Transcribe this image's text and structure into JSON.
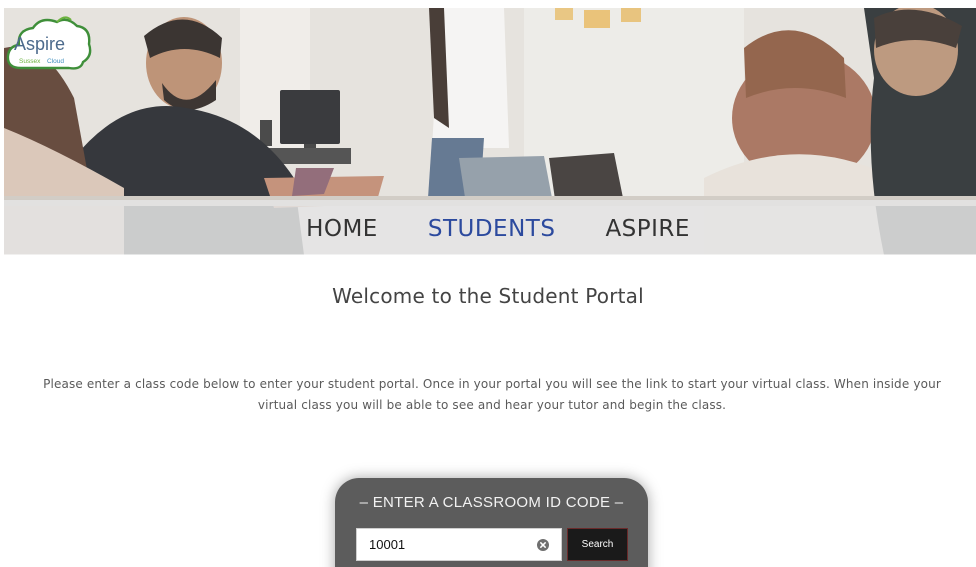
{
  "logo": {
    "text": "Aspire",
    "sub_left": "Sussex",
    "sub_right": "Cloud"
  },
  "nav": {
    "items": [
      {
        "label": "HOME",
        "active": false
      },
      {
        "label": "STUDENTS",
        "active": true
      },
      {
        "label": "ASPIRE",
        "active": false
      }
    ]
  },
  "main": {
    "welcome": "Welcome to the Student Portal",
    "intro": "Please enter a class code below to enter your student portal. Once in your portal you will see the link to start your virtual class. When inside your virtual class you will be able to see and hear your tutor and begin the class."
  },
  "search_panel": {
    "title": "– ENTER A CLASSROOM ID CODE –",
    "input_value": "10001",
    "button_label": "Search",
    "clear_icon": "clear-circle-icon"
  },
  "colors": {
    "nav_active": "#2c4a9e",
    "nav_text": "#333333",
    "panel_bg": "#5c5c5c",
    "button_bg": "#1a1a1a"
  }
}
